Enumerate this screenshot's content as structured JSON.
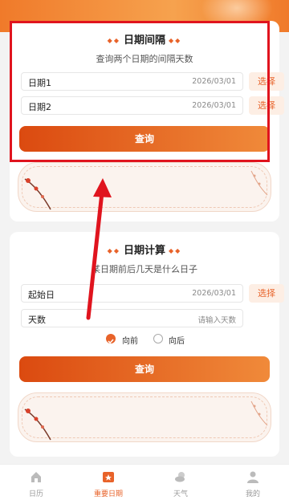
{
  "interval": {
    "title": "日期间隔",
    "subtitle": "查询两个日期的间隔天数",
    "date1_label": "日期1",
    "date1_value": "2026/03/01",
    "date2_label": "日期2",
    "date2_value": "2026/03/01",
    "pick_label": "选择",
    "query_label": "查询"
  },
  "calc": {
    "title": "日期计算",
    "subtitle": "某日期前后几天是什么日子",
    "start_label": "起始日",
    "start_value": "2026/03/01",
    "pick_label": "选择",
    "days_label": "天数",
    "days_placeholder": "请输入天数",
    "option_forward": "向前",
    "option_backward": "向后",
    "selected_option": "向前",
    "query_label": "查询"
  },
  "tabs": [
    {
      "label": "日历",
      "icon": "house-icon"
    },
    {
      "label": "重要日期",
      "icon": "calendar-star-icon"
    },
    {
      "label": "天气",
      "icon": "weather-icon"
    },
    {
      "label": "我的",
      "icon": "user-icon"
    }
  ],
  "active_tab": "重要日期",
  "colors": {
    "accent": "#e8632a",
    "highlight": "#e0141e"
  }
}
